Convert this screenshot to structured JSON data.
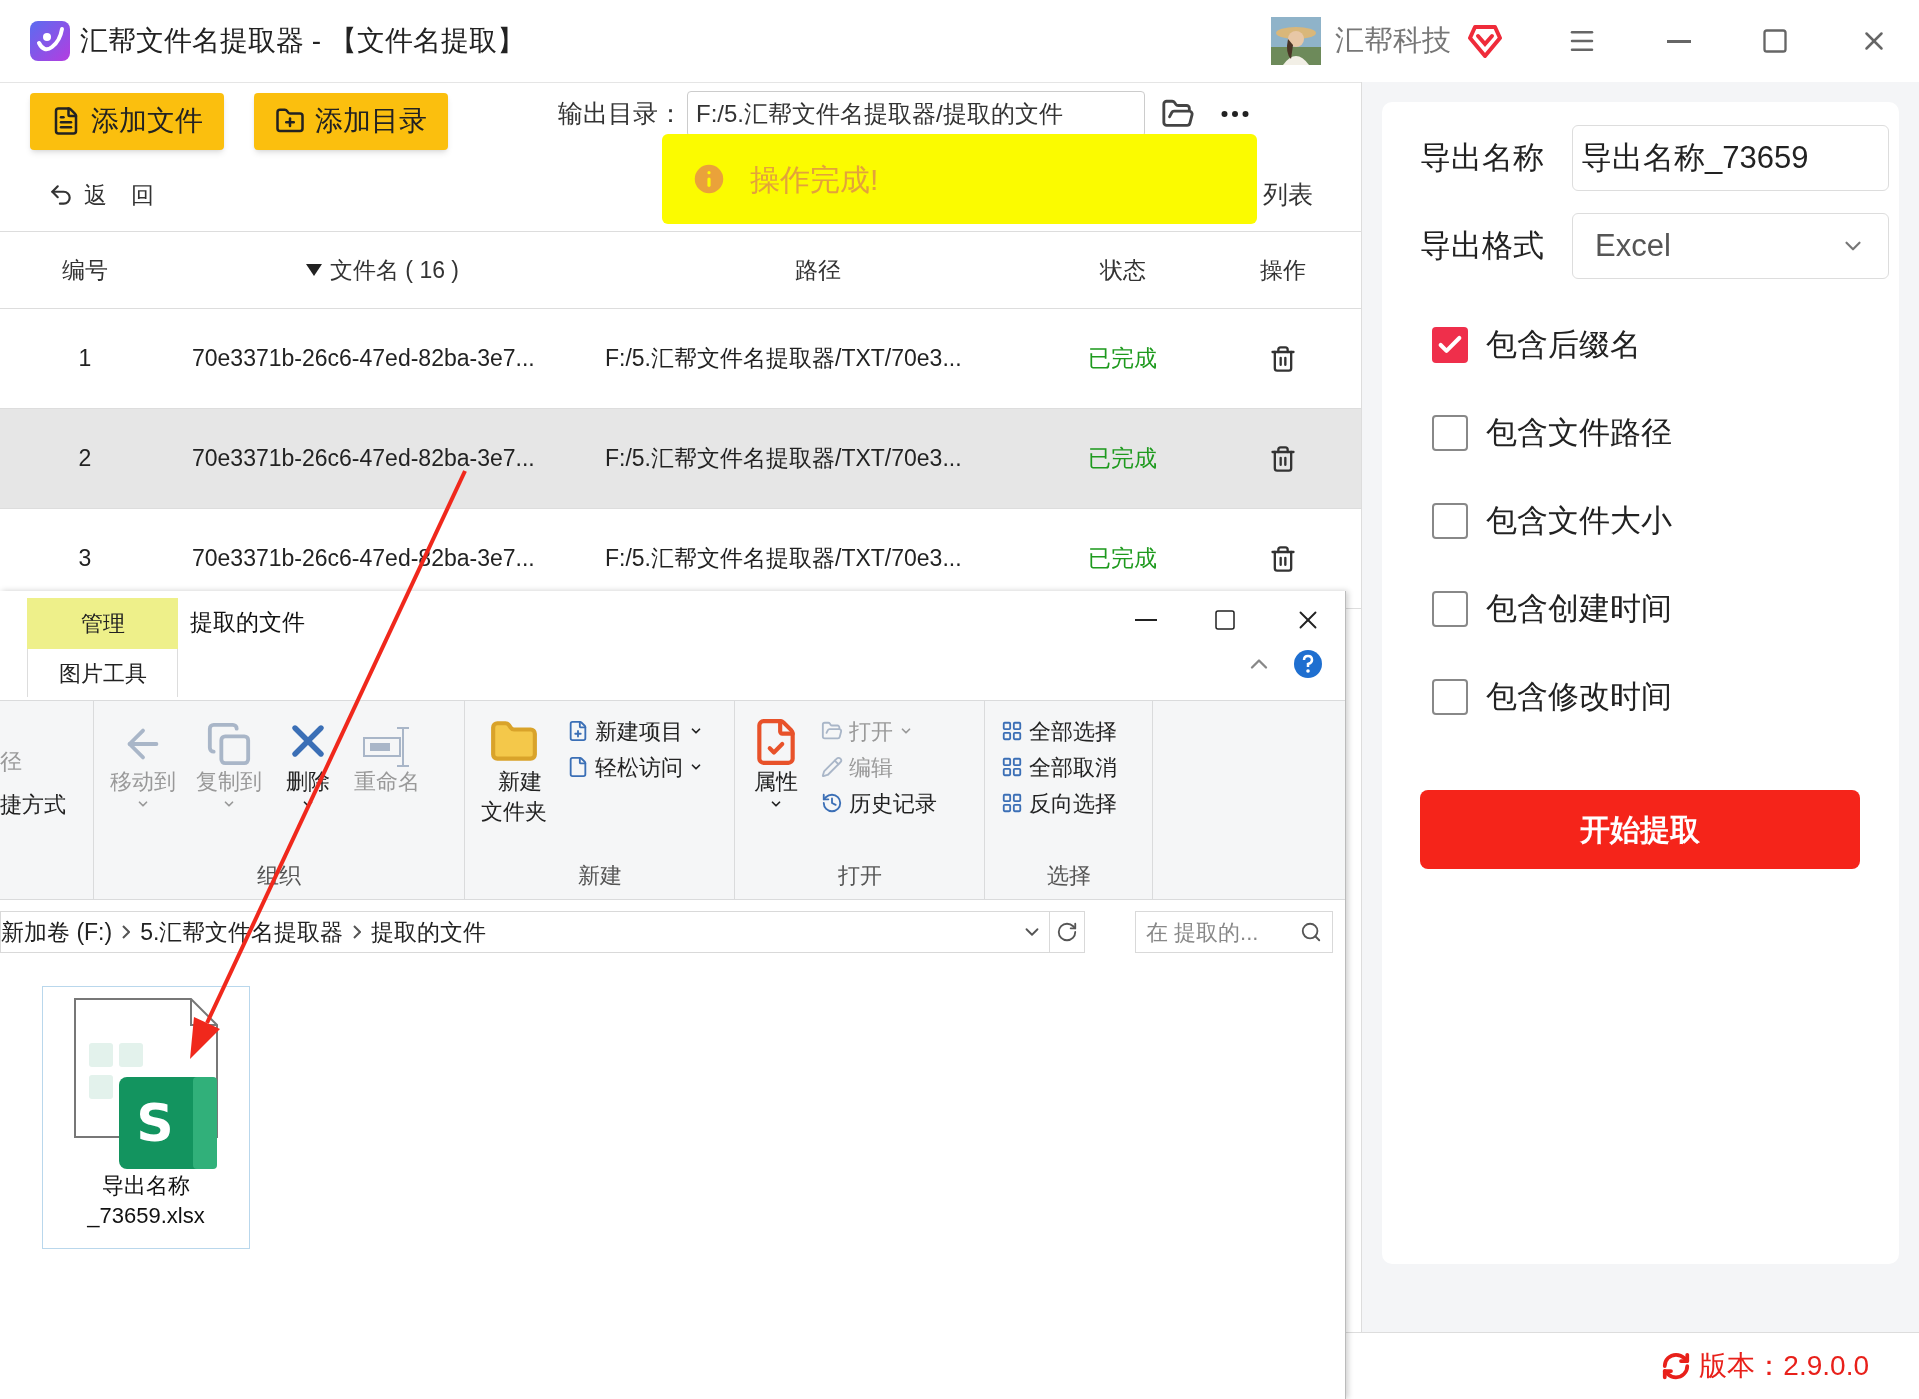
{
  "window": {
    "title": "汇帮文件名提取器 - 【文件名提取】",
    "brand": "汇帮科技"
  },
  "toolbar": {
    "buttons": [
      "添加文件",
      "添加目录"
    ],
    "output_label": "输出目录：",
    "output_path": "F:/5.汇帮文件名提取器/提取的文件",
    "back": "返 回",
    "list_button": "列表"
  },
  "toast": {
    "text": "操作完成!"
  },
  "table": {
    "columns": [
      {
        "label": "编号",
        "sorted": false
      },
      {
        "label": "文件名 ( 16 )",
        "sorted": true
      },
      {
        "label": "路径",
        "sorted": false
      },
      {
        "label": "状态",
        "sorted": false
      },
      {
        "label": "操作",
        "sorted": false
      }
    ],
    "rows": [
      {
        "index": "1",
        "name": "70e3371b-26c6-47ed-82ba-3e7...",
        "path": "F:/5.汇帮文件名提取器/TXT/70e3...",
        "status": "已完成",
        "selected": false
      },
      {
        "index": "2",
        "name": "70e3371b-26c6-47ed-82ba-3e7...",
        "path": "F:/5.汇帮文件名提取器/TXT/70e3...",
        "status": "已完成",
        "selected": true
      },
      {
        "index": "3",
        "name": "70e3371b-26c6-47ed-82ba-3e7...",
        "path": "F:/5.汇帮文件名提取器/TXT/70e3...",
        "status": "已完成",
        "selected": false
      }
    ]
  },
  "explorer": {
    "title": "提取的文件",
    "context_tab": "管理",
    "context_group": "图片工具",
    "clipped_items": [
      "径",
      "捷方式"
    ],
    "groups": [
      {
        "label": "组织",
        "items": [
          {
            "kind": "large",
            "label": "移动到",
            "dropdown": true,
            "disabled": true
          },
          {
            "kind": "large",
            "label": "复制到",
            "dropdown": true,
            "disabled": true
          },
          {
            "kind": "large",
            "label": "删除",
            "dropdown": true,
            "disabled": false
          },
          {
            "kind": "large",
            "label": "重命名",
            "dropdown": false,
            "disabled": true
          }
        ]
      },
      {
        "label": "新建",
        "items": [
          {
            "kind": "large",
            "label": "新建文件夹",
            "dropdown": false,
            "disabled": false
          },
          {
            "kind": "small",
            "label": "新建项目",
            "dropdown": true,
            "disabled": false
          },
          {
            "kind": "small",
            "label": "轻松访问",
            "dropdown": true,
            "disabled": false
          }
        ]
      },
      {
        "label": "打开",
        "items": [
          {
            "kind": "large",
            "label": "属性",
            "dropdown": true,
            "disabled": false
          },
          {
            "kind": "small",
            "label": "打开",
            "dropdown": true,
            "disabled": true
          },
          {
            "kind": "small",
            "label": "编辑",
            "dropdown": false,
            "disabled": true
          },
          {
            "kind": "small",
            "label": "历史记录",
            "dropdown": false,
            "disabled": false
          }
        ]
      },
      {
        "label": "选择",
        "items": [
          {
            "kind": "small",
            "label": "全部选择",
            "dropdown": false,
            "disabled": false
          },
          {
            "kind": "small",
            "label": "全部取消",
            "dropdown": false,
            "disabled": false
          },
          {
            "kind": "small",
            "label": "反向选择",
            "dropdown": false,
            "disabled": false
          }
        ]
      }
    ],
    "address": [
      "新加卷 (F:)",
      "5.汇帮文件名提取器",
      "提取的文件"
    ],
    "search_placeholder": "在 提取的...",
    "files": [
      {
        "name": "导出名称_73659.xlsx",
        "badge": "S",
        "selected": true
      }
    ]
  },
  "settings": {
    "name_label": "导出名称",
    "name_value": "导出名称_73659",
    "format_label": "导出格式",
    "format_value": "Excel",
    "options": [
      {
        "label": "包含后缀名",
        "checked": true
      },
      {
        "label": "包含文件路径",
        "checked": false
      },
      {
        "label": "包含文件大小",
        "checked": false
      },
      {
        "label": "包含创建时间",
        "checked": false
      },
      {
        "label": "包含修改时间",
        "checked": false
      }
    ],
    "start_button": "开始提取"
  },
  "footer": {
    "version": "版本：2.9.0.0"
  }
}
